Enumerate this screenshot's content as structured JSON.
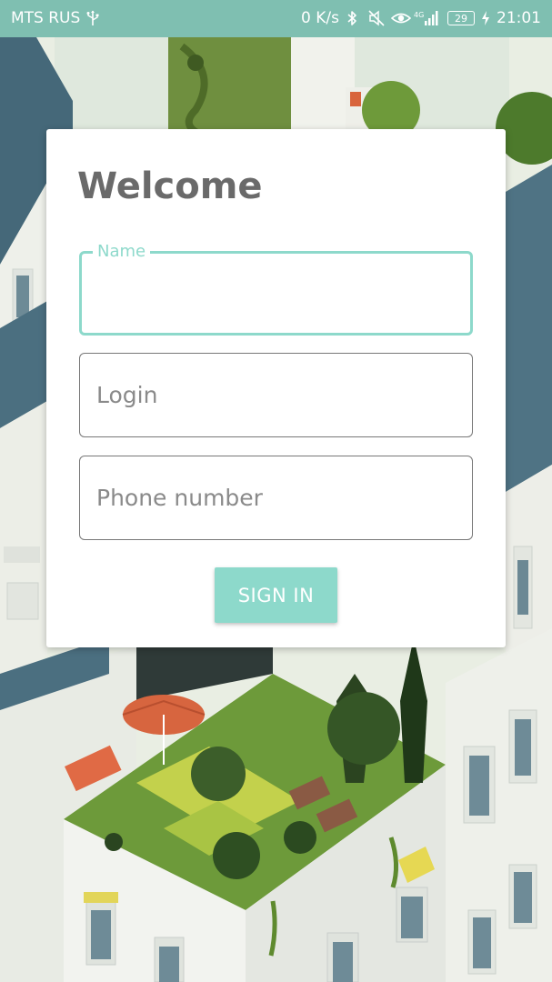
{
  "status_bar": {
    "carrier": "MTS RUS",
    "net_speed": "0 K/s",
    "network_type": "4G",
    "battery_level": "29",
    "time": "21:01",
    "icons": [
      "usb-icon",
      "bluetooth-icon",
      "mute-icon",
      "eye-icon",
      "signal-icon",
      "battery-icon",
      "charging-icon"
    ]
  },
  "form": {
    "title": "Welcome",
    "name": {
      "label": "Name",
      "value": "",
      "placeholder": ""
    },
    "login": {
      "value": "",
      "placeholder": "Login"
    },
    "phone": {
      "value": "",
      "placeholder": "Phone number"
    },
    "submit_label": "SIGN IN"
  },
  "theme": {
    "accent": "#8dd9cb",
    "status_bar": "#7fbfb1",
    "title_text": "#6a6a6a"
  }
}
